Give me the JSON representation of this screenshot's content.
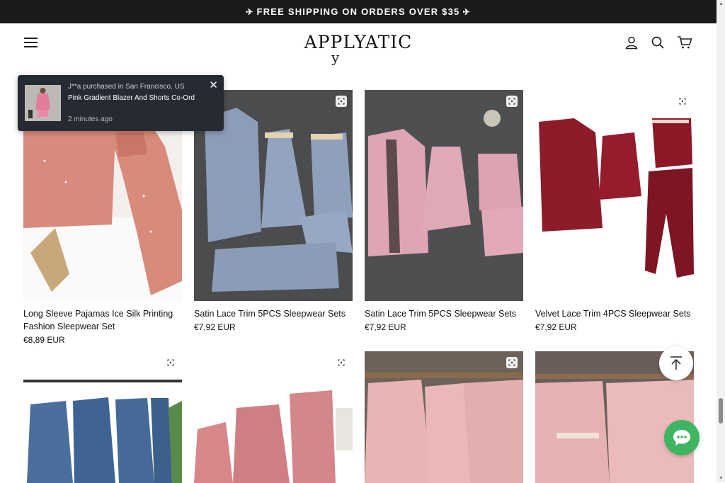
{
  "announcement": {
    "text": "FREE SHIPPING ON ORDERS OVER $35",
    "icon_left": "airplane-icon",
    "icon_right": "airplane-icon"
  },
  "header": {
    "logo": "APPLYATIC",
    "menu_icon": "hamburger-icon",
    "account_icon": "user-icon",
    "search_icon": "search-icon",
    "cart_icon": "cart-icon"
  },
  "section_heading_partial": "y",
  "popup": {
    "who": "J**a purchased in San Francisco, US",
    "product": "Pink Gradient Blazer And Shorts Co-Ord",
    "time": "2 minutes ago",
    "close": "✕"
  },
  "products": [
    {
      "title": "Long Sleeve Pajamas Ice Silk Printing Fashion Sleepwear Set",
      "price": "€8,89 EUR"
    },
    {
      "title": "Satin Lace Trim 5PCS Sleepwear Sets",
      "price": "€7,92 EUR"
    },
    {
      "title": "Satin Lace Trim 5PCS Sleepwear Sets",
      "price": "€7,92 EUR"
    },
    {
      "title": "Velvet Lace Trim 4PCS Sleepwear Sets",
      "price": "€7,92 EUR"
    }
  ],
  "colors": {
    "announce_bg": "#1a1a1a",
    "popup_bg": "#262b33",
    "chat_green": "#3fb562"
  }
}
